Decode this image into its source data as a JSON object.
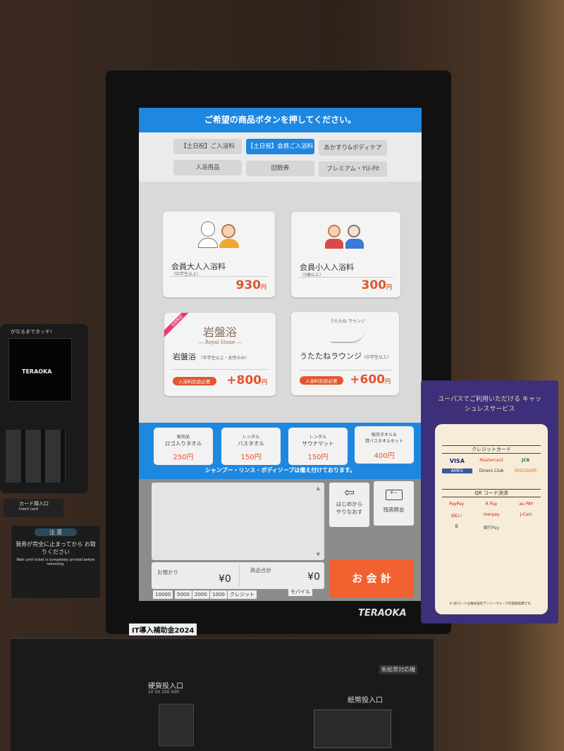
{
  "screen": {
    "header": "ご希望の商品ボタンを押してください。",
    "tabs": [
      {
        "label": "【土日祝】ご入浴料",
        "active": false
      },
      {
        "label": "【土日祝】会員ご入浴料",
        "active": true
      },
      {
        "label": "あかすり&ボディケア",
        "active": false
      },
      {
        "label": "入浴用品",
        "active": false
      },
      {
        "label": "回数券",
        "active": false
      },
      {
        "label": "プレミアム・YU-Fit",
        "active": false
      }
    ],
    "products": [
      {
        "name": "会員大人入浴料",
        "sub": "（中学生以上）",
        "price": "930",
        "unit": "円"
      },
      {
        "name": "会員小人入浴料",
        "sub": "（3歳以上）",
        "price": "300",
        "unit": "円"
      },
      {
        "name": "岩盤浴",
        "sub": "（中学生以上・女性のみ）",
        "price": "+800",
        "unit": "円",
        "badge": "女性限定",
        "note": "入浴料別途必要",
        "logo": "岩盤浴",
        "logo_sub": "— Royal Stone —"
      },
      {
        "name": "うたたねラウンジ",
        "sub": "（中学生以上）",
        "price": "+600",
        "unit": "円",
        "note": "入浴料別途必要",
        "logo": "うたたね ラウンジ"
      }
    ],
    "towels": [
      {
        "line1": "販売品",
        "line2": "ロゴ入りタオル",
        "price": "250円"
      },
      {
        "line1": "レンタル",
        "line2": "バスタオル",
        "price": "150円"
      },
      {
        "line1": "レンタル",
        "line2": "サウナマット",
        "price": "150円"
      },
      {
        "line1": "販売タオル＆",
        "line2": "貸バスタオルセット",
        "price": "400円"
      }
    ],
    "notice": "シャンプー・リンス・ボディソープは備え付けております。",
    "restart_label": "はじめから やりなおす",
    "balance_label": "残高照会",
    "deposit_label": "お預かり",
    "deposit_value": "¥0",
    "total_label": "商品合計",
    "total_value": "¥0",
    "checkout_label": "お 会 計",
    "payment_chips": [
      "10000",
      "5000",
      "2000",
      "1000",
      "クレジット"
    ],
    "mobile_chip": "モバイル",
    "colors": {
      "accent": "#1e88e0",
      "price": "#e2552d",
      "checkout": "#f0612f"
    }
  },
  "kiosk": {
    "brand": "TERAOKA",
    "subsidy": "IT導入補助金2024",
    "coin_slot": "硬貨投入口",
    "coin_values": "10 50 100 500",
    "bill_slot": "紙幣投入口",
    "new_bills": "新紙幣対応機",
    "terminal_brand": "TERAOKA",
    "terminal_top": "がなるまでタッチ!",
    "card_insert": "カード挿入口",
    "card_insert_en": "Insert card",
    "caution_title": "注 意",
    "caution_jp": "発券が完全に止まってから お取りください",
    "caution_en": "Wait until ticket is completely printed before removing."
  },
  "cashless": {
    "title": "ユーパスでご利用いただける キャッシュレスサービス",
    "credit_heading": "クレジットカード",
    "credit": [
      "VISA",
      "Mastercard",
      "JCB",
      "AMEX",
      "Diners Club",
      "DISCOVER"
    ],
    "qr_heading": "QR コード決済",
    "qr": [
      "PayPay",
      "R Pay",
      "au PAY",
      "d払い",
      "merpay",
      "J-Coin",
      "B",
      "銀行Pay"
    ],
    "footnote": "※ QRコードは株式会社デンソーウェーブの登録商標です。"
  }
}
